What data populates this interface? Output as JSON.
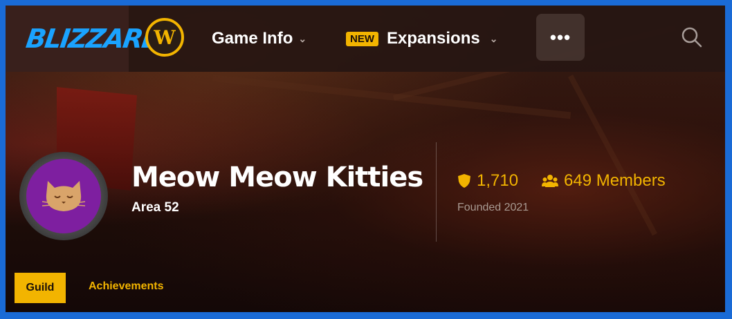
{
  "header": {
    "brand_logo": "BLIZZARD",
    "brand_chevron": "⌄",
    "game_logo_letter": "W",
    "nav": [
      {
        "label": "Game Info",
        "chevron": "⌄"
      },
      {
        "label": "Expansions",
        "badge": "NEW",
        "chevron": "⌄"
      }
    ],
    "more_label": "•••",
    "search_icon": "search-icon"
  },
  "guild": {
    "name": "Meow Meow Kitties",
    "realm": "Area 52",
    "achievement_points": "1,710",
    "members": "649 Members",
    "founded": "Founded 2021",
    "emblem_color": "#7e1fa0",
    "accent_color": "#f2b400"
  },
  "tabs": [
    {
      "label": "Guild",
      "active": true
    },
    {
      "label": "Achievements",
      "active": false
    }
  ]
}
